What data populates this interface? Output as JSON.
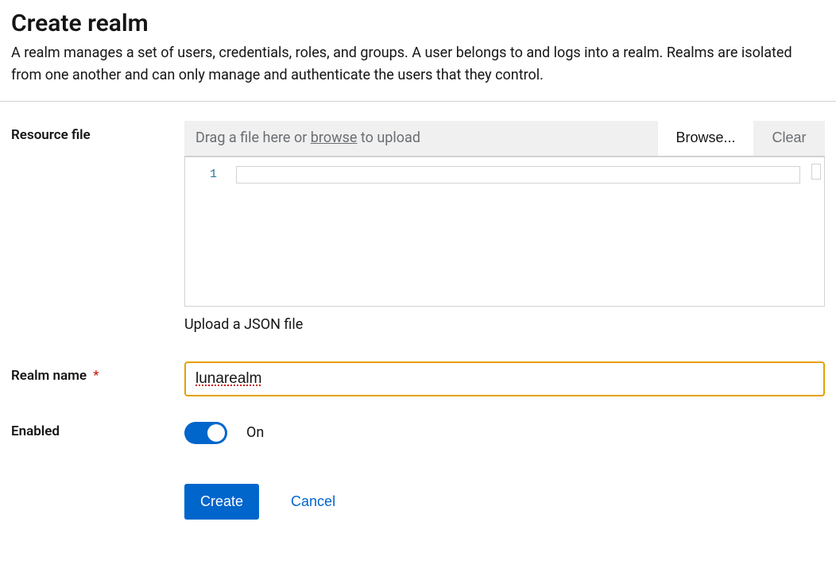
{
  "header": {
    "title": "Create realm",
    "description": "A realm manages a set of users, credentials, roles, and groups. A user belongs to and logs into a realm. Realms are isolated from one another and can only manage and authenticate the users that they control."
  },
  "form": {
    "resourceFile": {
      "label": "Resource file",
      "dropHint_prefix": "Drag a file here or ",
      "dropHint_link": "browse",
      "dropHint_suffix": " to upload",
      "browseLabel": "Browse...",
      "clearLabel": "Clear",
      "lineNumber": "1",
      "helperText": "Upload a JSON file"
    },
    "realmName": {
      "label": "Realm name",
      "required": "*",
      "value": "lunarealm"
    },
    "enabled": {
      "label": "Enabled",
      "stateLabel": "On"
    },
    "actions": {
      "create": "Create",
      "cancel": "Cancel"
    }
  }
}
